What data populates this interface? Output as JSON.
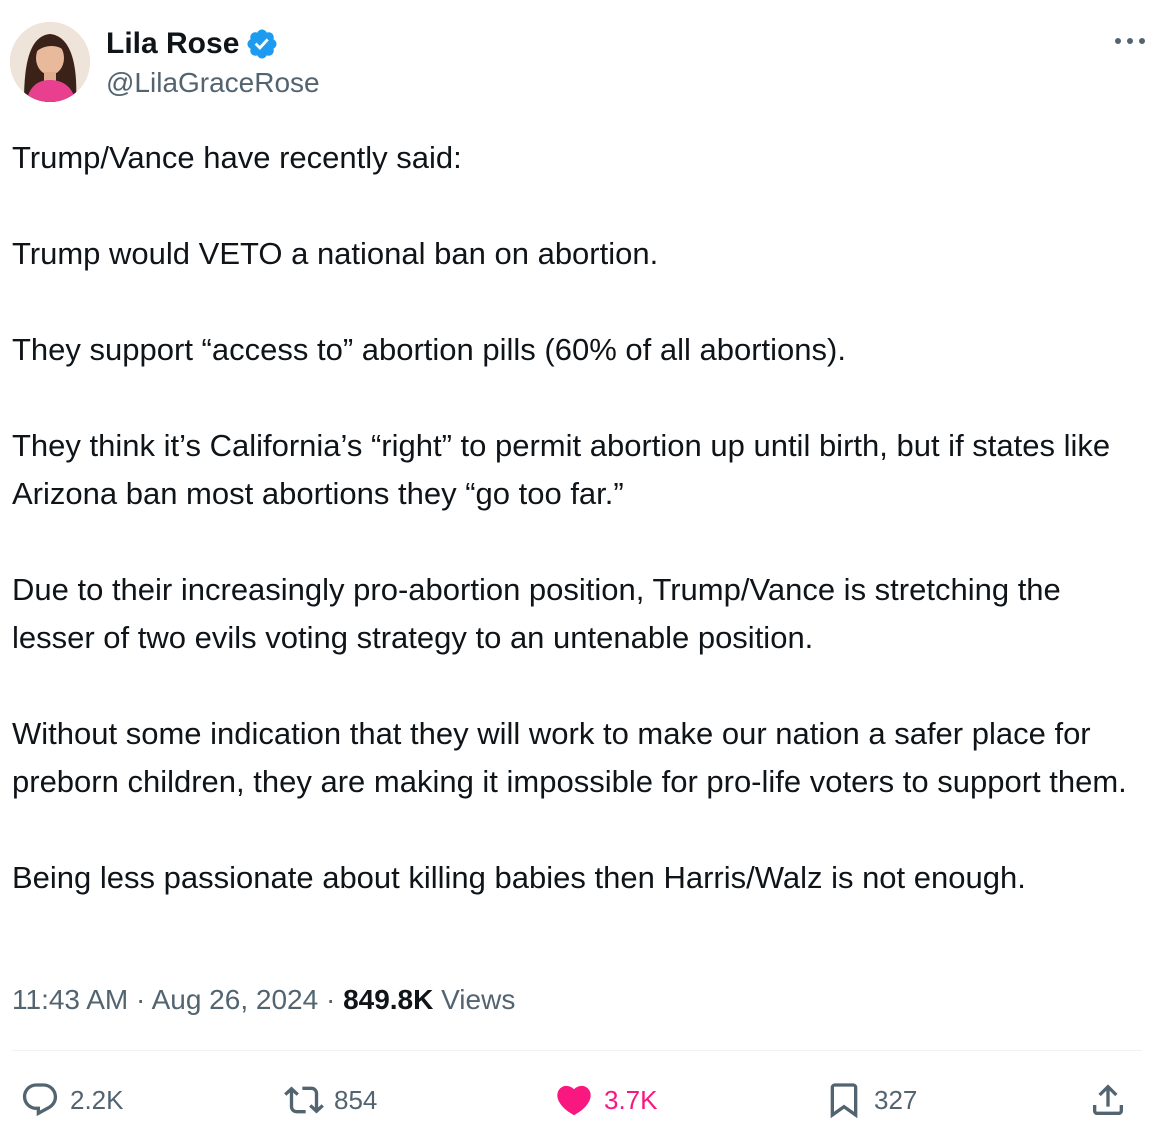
{
  "author": {
    "display_name": "Lila Rose",
    "handle": "@LilaGraceRose",
    "verified_icon": "verified-badge-icon",
    "avatar": "profile-photo"
  },
  "tweet": {
    "paragraphs": [
      "Trump/Vance have recently said:",
      "Trump would VETO a national ban on abortion.",
      "They support “access to” abortion pills (60% of all abortions).",
      "They think it’s California’s “right” to permit abortion up until birth, but if states like Arizona ban most abortions they “go too far.”",
      "Due to their increasingly pro-abortion position, Trump/Vance is stretching the lesser of two evils voting strategy to an untenable position.",
      "Without some indication that they will work to make our nation a safer place for preborn children, they are making it impossible for pro-life voters to support them.",
      "Being less passionate about killing babies then Harris/Walz is not enough."
    ]
  },
  "meta": {
    "time": "11:43 AM",
    "separator": " · ",
    "date": "Aug 26, 2024",
    "views_count": "849.8K",
    "views_label": " Views"
  },
  "actions": {
    "replies": "2.2K",
    "retweets": "854",
    "likes": "3.7K",
    "bookmarks": "327"
  },
  "colors": {
    "text": "#0f1419",
    "secondary": "#536471",
    "verified": "#1d9bf0",
    "like": "#f91880",
    "divider": "#eff3f4"
  }
}
